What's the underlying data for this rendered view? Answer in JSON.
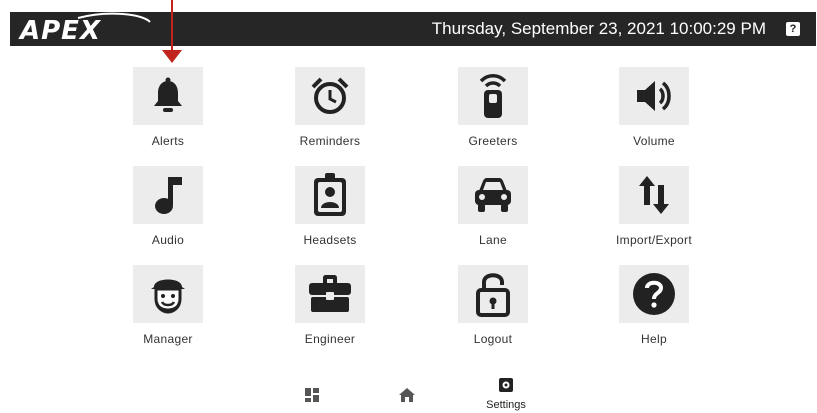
{
  "header": {
    "logo_text": "APEX",
    "datetime": "Thursday, September 23, 2021 10:00:29 PM",
    "help_glyph": "?",
    "help_icon": "question-icon"
  },
  "tiles": [
    {
      "label": "Alerts",
      "icon": "bell-icon"
    },
    {
      "label": "Reminders",
      "icon": "alarm-clock-icon"
    },
    {
      "label": "Greeters",
      "icon": "remote-signal-icon"
    },
    {
      "label": "Volume",
      "icon": "speaker-icon"
    },
    {
      "label": "Audio",
      "icon": "music-note-icon"
    },
    {
      "label": "Headsets",
      "icon": "badge-person-icon"
    },
    {
      "label": "Lane",
      "icon": "car-icon"
    },
    {
      "label": "Import/Export",
      "icon": "up-down-arrows-icon"
    },
    {
      "label": "Manager",
      "icon": "manager-avatar-icon"
    },
    {
      "label": "Engineer",
      "icon": "briefcase-icon"
    },
    {
      "label": "Logout",
      "icon": "lock-open-icon"
    },
    {
      "label": "Help",
      "icon": "help-circle-icon"
    }
  ],
  "bottom_nav": {
    "dashboard_icon": "dashboard-icon",
    "home_icon": "home-icon",
    "settings_label": "Settings",
    "settings_icon": "gear-icon"
  },
  "annotation": {
    "color": "#c0241c",
    "target": "Alerts"
  }
}
